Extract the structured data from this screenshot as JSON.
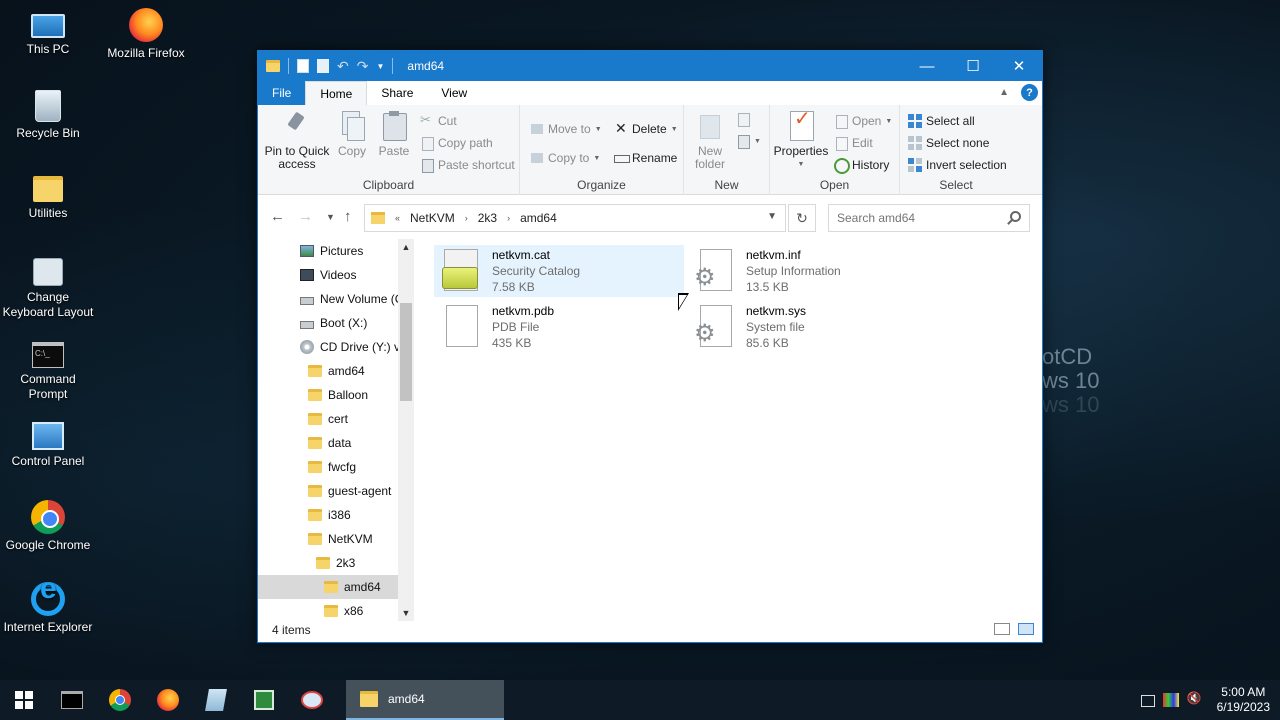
{
  "desktop": {
    "icons": [
      {
        "label": "This PC"
      },
      {
        "label": "Mozilla Firefox"
      },
      {
        "label": "Recycle Bin"
      },
      {
        "label": "Utilities"
      },
      {
        "label": "Change Keyboard Layout"
      },
      {
        "label": "Command Prompt"
      },
      {
        "label": "Control Panel"
      },
      {
        "label": "Google Chrome"
      },
      {
        "label": "Internet Explorer"
      }
    ],
    "wallpaper_text": [
      "otCD",
      "ws 10",
      "ws 10"
    ]
  },
  "window": {
    "title": "amd64",
    "controls": {
      "minimize": "—",
      "maximize": "☐",
      "close": "✕"
    }
  },
  "ribbon": {
    "tabs": [
      "File",
      "Home",
      "Share",
      "View"
    ],
    "help": "?",
    "clipboard": {
      "label": "Clipboard",
      "pin": "Pin to Quick access",
      "copy": "Copy",
      "paste": "Paste",
      "cut": "Cut",
      "copy_path": "Copy path",
      "paste_shortcut": "Paste shortcut"
    },
    "organize": {
      "label": "Organize",
      "move_to": "Move to",
      "copy_to": "Copy to",
      "delete": "Delete",
      "rename": "Rename"
    },
    "new": {
      "label": "New",
      "new_folder": "New folder"
    },
    "open": {
      "label": "Open",
      "properties": "Properties",
      "open": "Open",
      "edit": "Edit",
      "history": "History"
    },
    "select": {
      "label": "Select",
      "select_all": "Select all",
      "select_none": "Select none",
      "invert": "Invert selection"
    }
  },
  "address": {
    "prefix": "«",
    "crumbs": [
      "NetKVM",
      "2k3",
      "amd64"
    ],
    "search_placeholder": "Search amd64"
  },
  "nav": {
    "items": [
      "Pictures",
      "Videos",
      "New Volume (C",
      "Boot (X:)",
      "CD Drive (Y:) vi",
      "amd64",
      "Balloon",
      "cert",
      "data",
      "fwcfg",
      "guest-agent",
      "i386",
      "NetKVM",
      "2k3",
      "amd64",
      "x86"
    ]
  },
  "files": [
    {
      "name": "netkvm.cat",
      "type": "Security Catalog",
      "size": "7.58 KB",
      "icon": "catalog-icon"
    },
    {
      "name": "netkvm.inf",
      "type": "Setup Information",
      "size": "13.5 KB",
      "icon": "setup-info-icon"
    },
    {
      "name": "netkvm.pdb",
      "type": "PDB File",
      "size": "435 KB",
      "icon": "document-icon"
    },
    {
      "name": "netkvm.sys",
      "type": "System file",
      "size": "85.6 KB",
      "icon": "system-file-icon"
    }
  ],
  "status": {
    "item_count": "4 items"
  },
  "taskbar": {
    "active_task": "amd64",
    "clock_time": "5:00 AM",
    "clock_date": "6/19/2023"
  },
  "colors": {
    "accent": "#1979ca",
    "selection": "#e5f3ff"
  }
}
